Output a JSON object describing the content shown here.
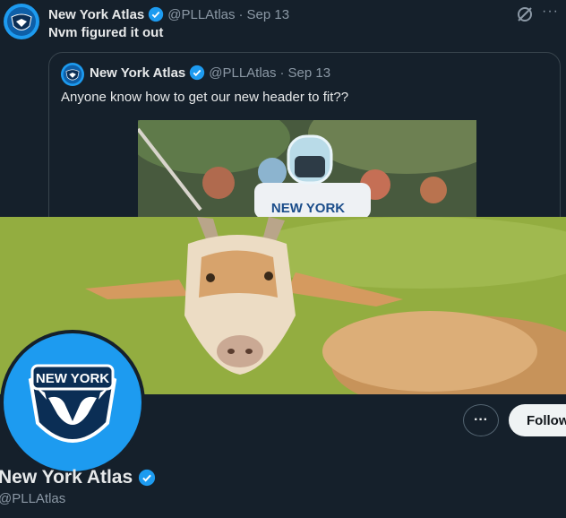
{
  "tweet": {
    "author_name": "New York Atlas",
    "handle": "@PLLAtlas",
    "separator": "·",
    "date": "Sep 13",
    "text": "Nvm figured it out",
    "more": "···"
  },
  "quoted": {
    "author_name": "New York Atlas",
    "handle": "@PLLAtlas",
    "separator": "·",
    "date": "Sep 13",
    "text": "Anyone know how to get our new header to fit??",
    "jersey_text": "NEW YORK"
  },
  "profile": {
    "logo_text": "NEW YORK",
    "name": "New York Atlas",
    "handle": "@PLLAtlas",
    "more_label": "···",
    "follow_label": "Follow"
  },
  "colors": {
    "background": "#15202b",
    "accent": "#1d9bf0",
    "muted": "#8b98a5"
  },
  "icons": [
    "verified-badge-icon",
    "grok-icon",
    "more-icon",
    "new-york-atlas-logo"
  ]
}
